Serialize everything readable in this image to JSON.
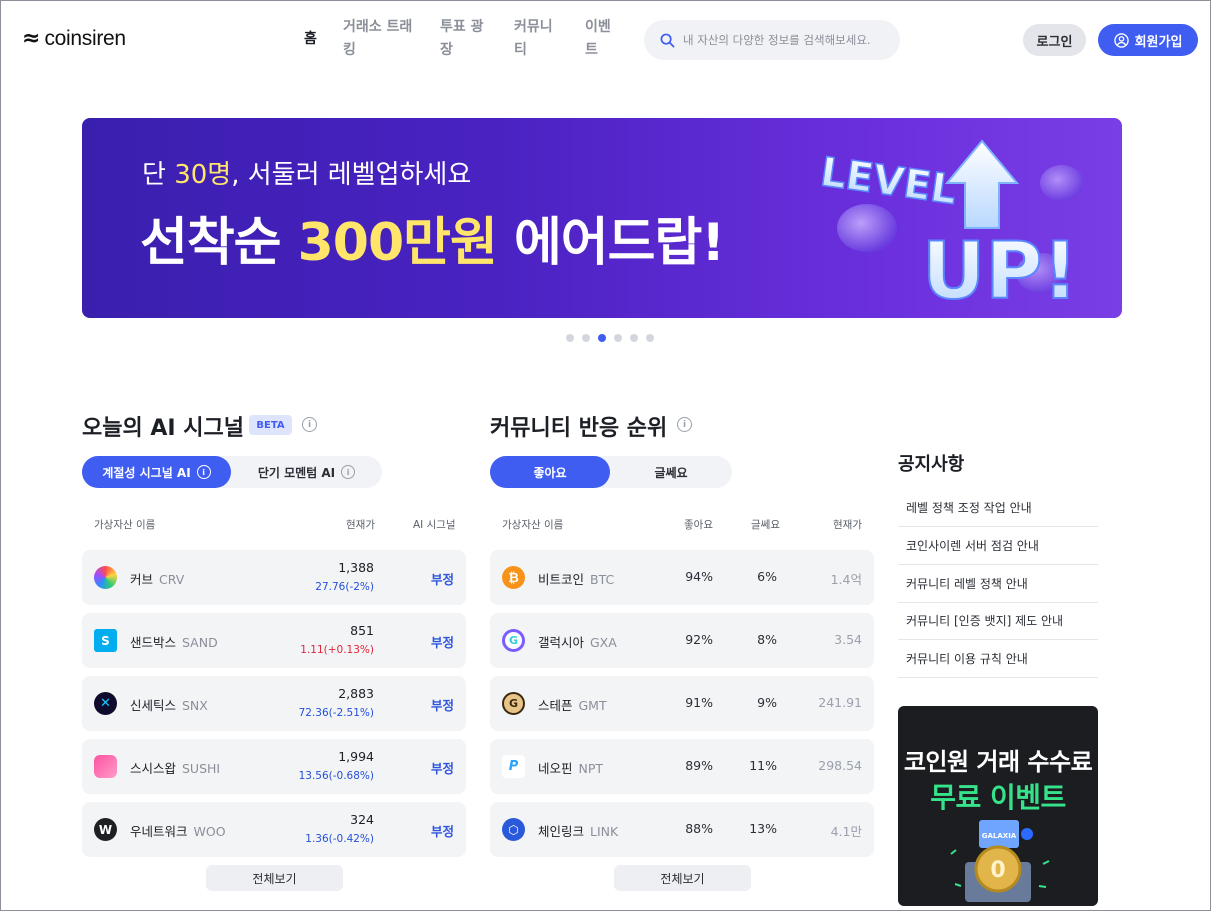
{
  "header": {
    "logo_text": "coinsiren",
    "nav": [
      {
        "label": "홈"
      },
      {
        "label_line1": "거래소 트래",
        "label_line2": "킹"
      },
      {
        "label_line1": "투표 광",
        "label_line2": "장"
      },
      {
        "label_line1": "커뮤니",
        "label_line2": "티"
      },
      {
        "label_line1": "이벤",
        "label_line2": "트"
      }
    ],
    "search_placeholder": "내 자산의 다양한 정보를 검색해보세요.",
    "login_label": "로그인",
    "signup_label": "회원가입"
  },
  "banner": {
    "sub_prefix": "단 ",
    "sub_highlight": "30명",
    "sub_suffix": ", 서둘러 레벨업하세요",
    "main_prefix": "선착순 ",
    "main_highlight": "300만원",
    "main_suffix": " 에어드랍!",
    "art_text_1": "LEVEL",
    "art_text_2": "UP!",
    "slide_count": 6,
    "active_slide": 3
  },
  "ai_signal": {
    "title": "오늘의 AI 시그널",
    "badge": "BETA",
    "tabs": [
      "계절성 시그널 AI",
      "단기 모멘텀 AI"
    ],
    "columns": [
      "가상자산 이름",
      "현재가",
      "AI 시그널"
    ],
    "rows": [
      {
        "name": "커브",
        "symbol": "CRV",
        "price": "1,388",
        "change": "27.76(-2%)",
        "dir": "down",
        "signal": "부정"
      },
      {
        "name": "샌드박스",
        "symbol": "SAND",
        "price": "851",
        "change": "1.11(+0.13%)",
        "dir": "up",
        "signal": "부정"
      },
      {
        "name": "신세틱스",
        "symbol": "SNX",
        "price": "2,883",
        "change": "72.36(-2.51%)",
        "dir": "down",
        "signal": "부정"
      },
      {
        "name": "스시스왑",
        "symbol": "SUSHI",
        "price": "1,994",
        "change": "13.56(-0.68%)",
        "dir": "down",
        "signal": "부정"
      },
      {
        "name": "우네트워크",
        "symbol": "WOO",
        "price": "324",
        "change": "1.36(-0.42%)",
        "dir": "down",
        "signal": "부정"
      }
    ],
    "more_label": "전체보기"
  },
  "community": {
    "title": "커뮤니티 반응 순위",
    "tabs": [
      "좋아요",
      "글쎄요"
    ],
    "columns": [
      "가상자산 이름",
      "좋아요",
      "글쎄요",
      "현재가"
    ],
    "rows": [
      {
        "name": "비트코인",
        "symbol": "BTC",
        "like": "94%",
        "meh": "6%",
        "price": "1.4억"
      },
      {
        "name": "갤럭시아",
        "symbol": "GXA",
        "like": "92%",
        "meh": "8%",
        "price": "3.54"
      },
      {
        "name": "스테픈",
        "symbol": "GMT",
        "like": "91%",
        "meh": "9%",
        "price": "241.91"
      },
      {
        "name": "네오핀",
        "symbol": "NPT",
        "like": "89%",
        "meh": "11%",
        "price": "298.54"
      },
      {
        "name": "체인링크",
        "symbol": "LINK",
        "like": "88%",
        "meh": "13%",
        "price": "4.1만"
      }
    ],
    "more_label": "전체보기"
  },
  "notices": {
    "title": "공지사항",
    "items": [
      "레벨 정책 조정 작업 안내",
      "코인사이렌 서버 점검 안내",
      "커뮤니티 레벨 정책 안내",
      "커뮤니티 [인증 뱃지] 제도 안내",
      "커뮤니티 이용 규칙 안내"
    ]
  },
  "promo": {
    "line1": "코인원 거래 수수료",
    "line2": "무료 이벤트",
    "art_label": "GALAXIA"
  },
  "colors": {
    "accent": "#3f5df0",
    "banner_bg": "#4a22c2",
    "highlight_yellow": "#ffe66a",
    "price_down": "#2450d8",
    "price_up": "#e0263a",
    "promo_green": "#36e38a"
  }
}
